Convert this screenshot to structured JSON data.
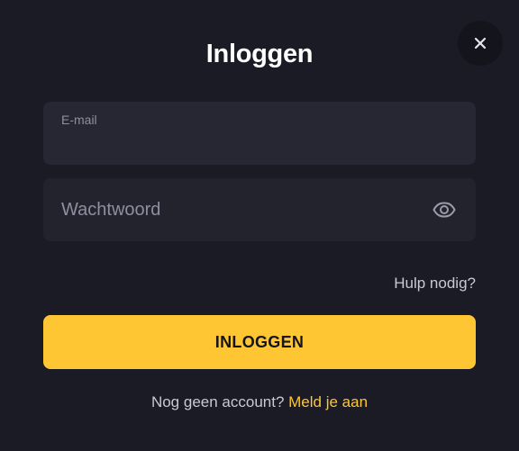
{
  "modal": {
    "title": "Inloggen",
    "close_icon": "close-icon"
  },
  "email": {
    "label": "E-mail",
    "value": ""
  },
  "password": {
    "placeholder": "Wachtwoord",
    "value": "",
    "toggle_icon": "eye-icon"
  },
  "help": {
    "label": "Hulp nodig?"
  },
  "submit": {
    "label": "INLOGGEN"
  },
  "signup": {
    "prompt": "Nog geen account?",
    "link_label": "Meld je aan"
  },
  "colors": {
    "background": "#1b1b26",
    "field": "#272733",
    "accent": "#ffc634",
    "muted_text": "#8e8e9e"
  }
}
